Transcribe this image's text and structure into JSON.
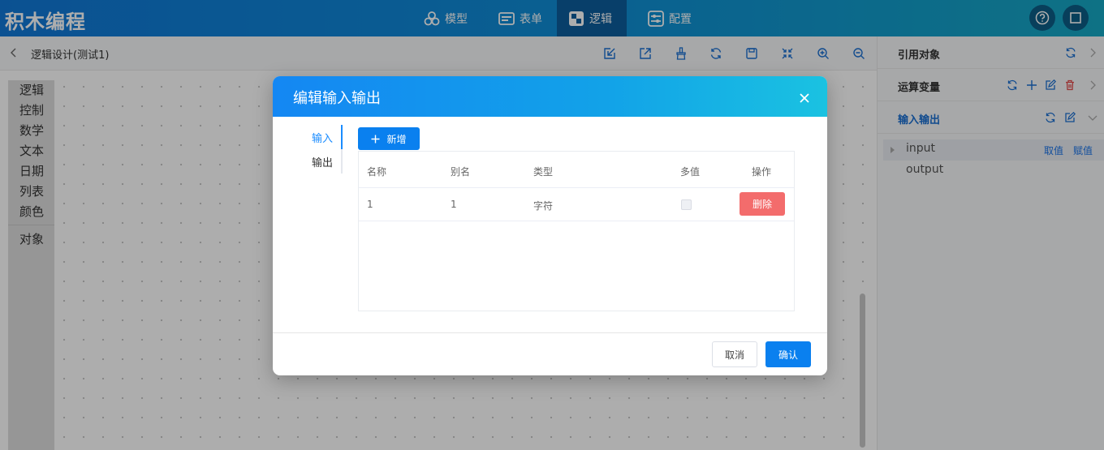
{
  "app": {
    "title": "积木编程"
  },
  "nav": {
    "tabs": [
      {
        "label": "模型",
        "icon": "model-icon"
      },
      {
        "label": "表单",
        "icon": "form-icon"
      },
      {
        "label": "逻辑",
        "icon": "logic-icon",
        "active": true
      },
      {
        "label": "配置",
        "icon": "config-icon"
      }
    ],
    "right_icons": [
      "help-icon",
      "window-icon"
    ]
  },
  "subbar": {
    "title": "逻辑设计(测试1)",
    "tools": [
      "import-icon",
      "export-icon",
      "clear-icon",
      "refresh-icon",
      "save-icon",
      "fit-icon",
      "zoom-in-icon",
      "zoom-out-icon"
    ]
  },
  "toolbox": {
    "items": [
      "逻辑",
      "控制",
      "数学",
      "文本",
      "日期",
      "列表",
      "颜色"
    ],
    "extra": [
      "对象"
    ]
  },
  "right_panel": {
    "sections": [
      {
        "title": "引用对象"
      },
      {
        "title": "运算变量"
      },
      {
        "title": "输入输出",
        "active": true
      }
    ],
    "io_items": [
      {
        "label": "input",
        "actions": [
          "取值",
          "赋值"
        ]
      },
      {
        "label": "output"
      }
    ]
  },
  "modal": {
    "title": "编辑输入输出",
    "tabs": [
      "输入",
      "输出"
    ],
    "active_tab": "输入",
    "add_label": "新增",
    "columns": [
      "名称",
      "别名",
      "类型",
      "多值",
      "操作"
    ],
    "rows": [
      {
        "name": "1",
        "alias": "1",
        "type": "字符",
        "multi": false,
        "action": "删除"
      }
    ],
    "cancel_label": "取消",
    "confirm_label": "确认"
  },
  "colors": {
    "primary": "#0a80ef",
    "danger": "#f36c6c",
    "header_gradient_start": "#1178d8",
    "header_gradient_end": "#16a8c4"
  }
}
